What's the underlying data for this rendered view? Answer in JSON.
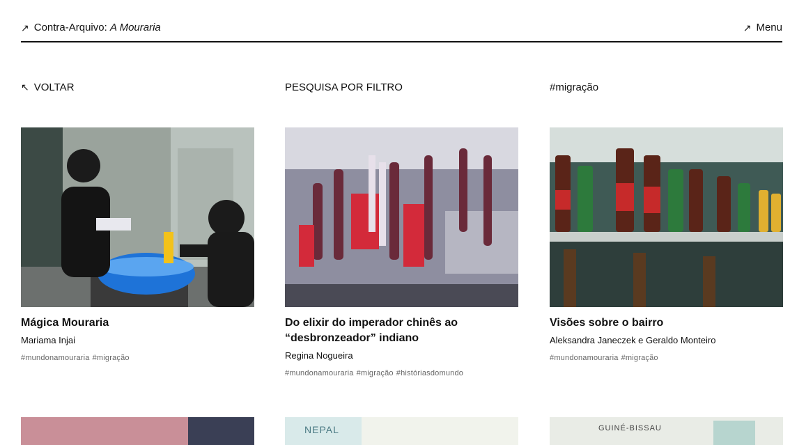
{
  "header": {
    "arrow": "↗",
    "site_prefix": "Contra-Arquivo: ",
    "site_name": "A Mouraria",
    "menu_arrow": "↗",
    "menu_label": "Menu"
  },
  "nav": {
    "back_arrow": "↖",
    "back_label": "VOLTAR",
    "filter_label": "PESQUISA POR FILTRO",
    "active_tag": "#migração"
  },
  "cards": [
    {
      "title": "Mágica Mouraria",
      "author": "Mariama Injai",
      "tags": [
        "#mundonamouraria",
        "#migração"
      ],
      "image": "children-washing-photo"
    },
    {
      "title": "Do elixir do imperador chinês ao “desbronzeador” indiano",
      "author": "Regina Nogueira",
      "tags": [
        "#mundonamouraria",
        "#migração",
        "#históriasdomundo"
      ],
      "image": "hanging-goods-shop-photo"
    },
    {
      "title": "Visões sobre o bairro",
      "author": "Aleksandra Janeczek e Geraldo Monteiro",
      "tags": [
        "#mundonamouraria",
        "#migração"
      ],
      "image": "sauce-bottles-shelf-photo"
    }
  ],
  "bottom_cards": [
    {
      "label": "",
      "image": "pink-wall-photo"
    },
    {
      "label": "NEPAL",
      "image": "nepal-map-photo"
    },
    {
      "label": "GUINÉ-BISSAU",
      "image": "guinea-bissau-map-photo"
    }
  ]
}
